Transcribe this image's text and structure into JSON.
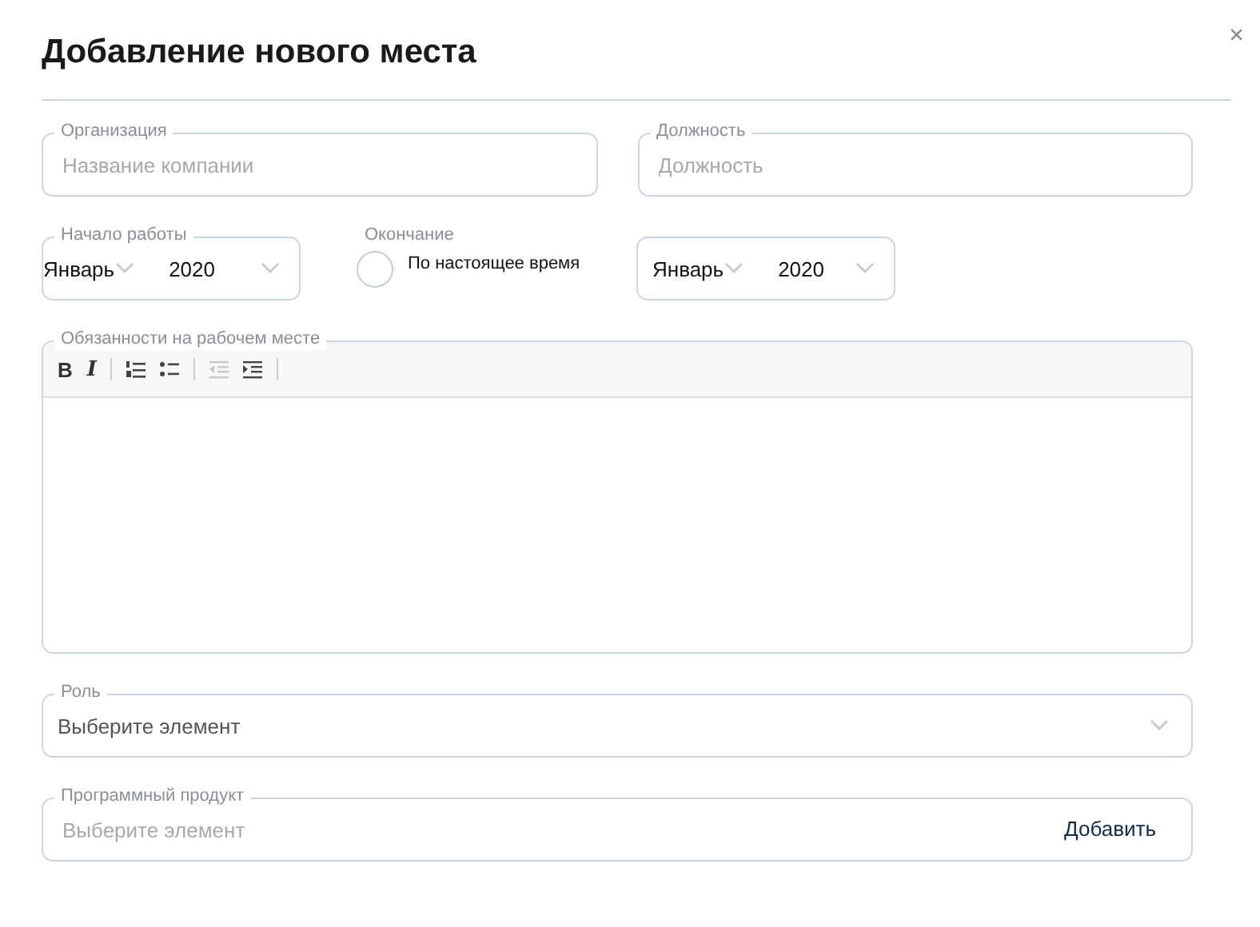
{
  "dialog": {
    "title": "Добавление нового места",
    "close": "×"
  },
  "organization": {
    "label": "Организация",
    "placeholder": "Название компании"
  },
  "position": {
    "label": "Должность",
    "placeholder": "Должность"
  },
  "start": {
    "label": "Начало работы",
    "month": "Январь",
    "year": "2020"
  },
  "end": {
    "label": "Окончание",
    "present": {
      "label": "По настоящее время",
      "checked": false
    },
    "month": "Январь",
    "year": "2020"
  },
  "duties": {
    "label": "Обязанности на рабочем месте",
    "toolbar": [
      {
        "kind": "bold",
        "label": "B",
        "disabled": false
      },
      {
        "kind": "italic",
        "label": "I",
        "disabled": false
      },
      {
        "kind": "separator"
      },
      {
        "kind": "ordered-list",
        "disabled": false
      },
      {
        "kind": "bullet-list",
        "disabled": false
      },
      {
        "kind": "separator"
      },
      {
        "kind": "outdent",
        "disabled": true
      },
      {
        "kind": "indent",
        "disabled": false
      },
      {
        "kind": "separator"
      }
    ]
  },
  "role": {
    "label": "Роль",
    "value": "Выберите элемент"
  },
  "product": {
    "label": "Программный продукт",
    "placeholder": "Выберите элемент",
    "action": "Добавить"
  }
}
